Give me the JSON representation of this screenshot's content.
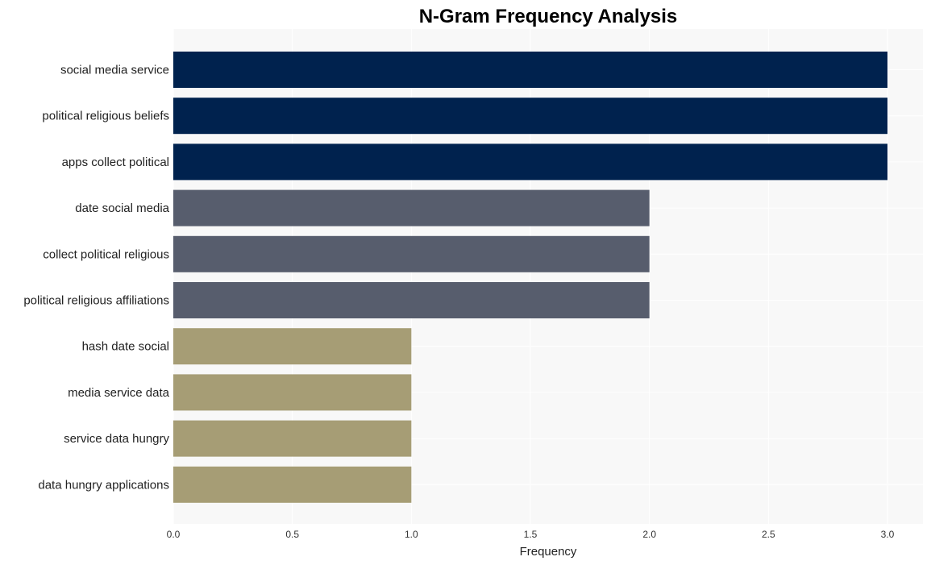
{
  "chart_data": {
    "type": "bar",
    "orientation": "horizontal",
    "title": "N-Gram Frequency Analysis",
    "xlabel": "Frequency",
    "ylabel": "",
    "xlim": [
      0,
      3.15
    ],
    "xticks": [
      "0.0",
      "0.5",
      "1.0",
      "1.5",
      "2.0",
      "2.5",
      "3.0"
    ],
    "grid": true,
    "categories": [
      "social media service",
      "political religious beliefs",
      "apps collect political",
      "date social media",
      "collect political religious",
      "political religious affiliations",
      "hash date social",
      "media service data",
      "service data hungry",
      "data hungry applications"
    ],
    "values": [
      3,
      3,
      3,
      2,
      2,
      2,
      1,
      1,
      1,
      1
    ],
    "colors": [
      "#00224e",
      "#00224e",
      "#00224e",
      "#575d6d",
      "#575d6d",
      "#575d6d",
      "#a69d75",
      "#a69d75",
      "#a69d75",
      "#a69d75"
    ],
    "background": "#f8f8f8"
  }
}
